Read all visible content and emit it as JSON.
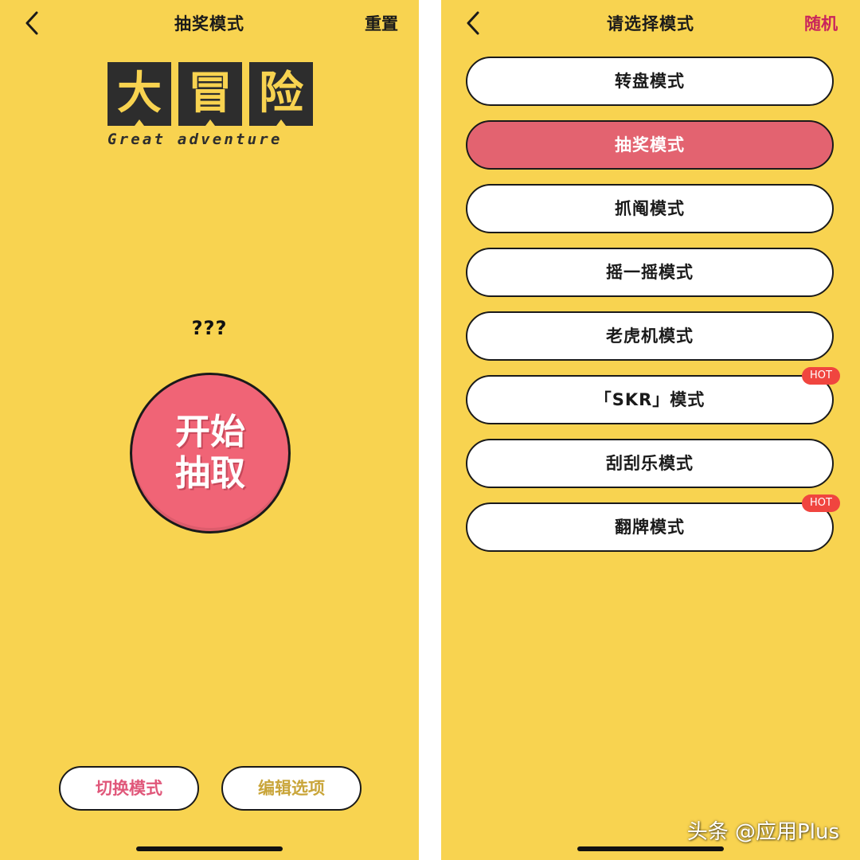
{
  "colors": {
    "background": "#f8d350",
    "start_button": "#f06476",
    "active_mode": "#e36370",
    "hot_badge": "#f0453f",
    "random_text": "#c9245c"
  },
  "left_screen": {
    "title": "抽奖模式",
    "reset_label": "重置",
    "logo": {
      "chars": [
        "大",
        "冒",
        "险"
      ],
      "subtitle": "Great adventure"
    },
    "result_text": "???",
    "start_button": {
      "line1": "开始",
      "line2": "抽取"
    },
    "switch_mode_label": "切换模式",
    "edit_options_label": "编辑选项"
  },
  "right_screen": {
    "title": "请选择模式",
    "random_label": "随机",
    "modes": [
      {
        "label": "转盘模式",
        "active": false,
        "badge": ""
      },
      {
        "label": "抽奖模式",
        "active": true,
        "badge": ""
      },
      {
        "label": "抓阄模式",
        "active": false,
        "badge": ""
      },
      {
        "label": "摇一摇模式",
        "active": false,
        "badge": ""
      },
      {
        "label": "老虎机模式",
        "active": false,
        "badge": ""
      },
      {
        "label": "「SKR」模式",
        "active": false,
        "badge": "HOT"
      },
      {
        "label": "刮刮乐模式",
        "active": false,
        "badge": ""
      },
      {
        "label": "翻牌模式",
        "active": false,
        "badge": "HOT"
      }
    ]
  },
  "watermark": "头条 @应用Plus"
}
